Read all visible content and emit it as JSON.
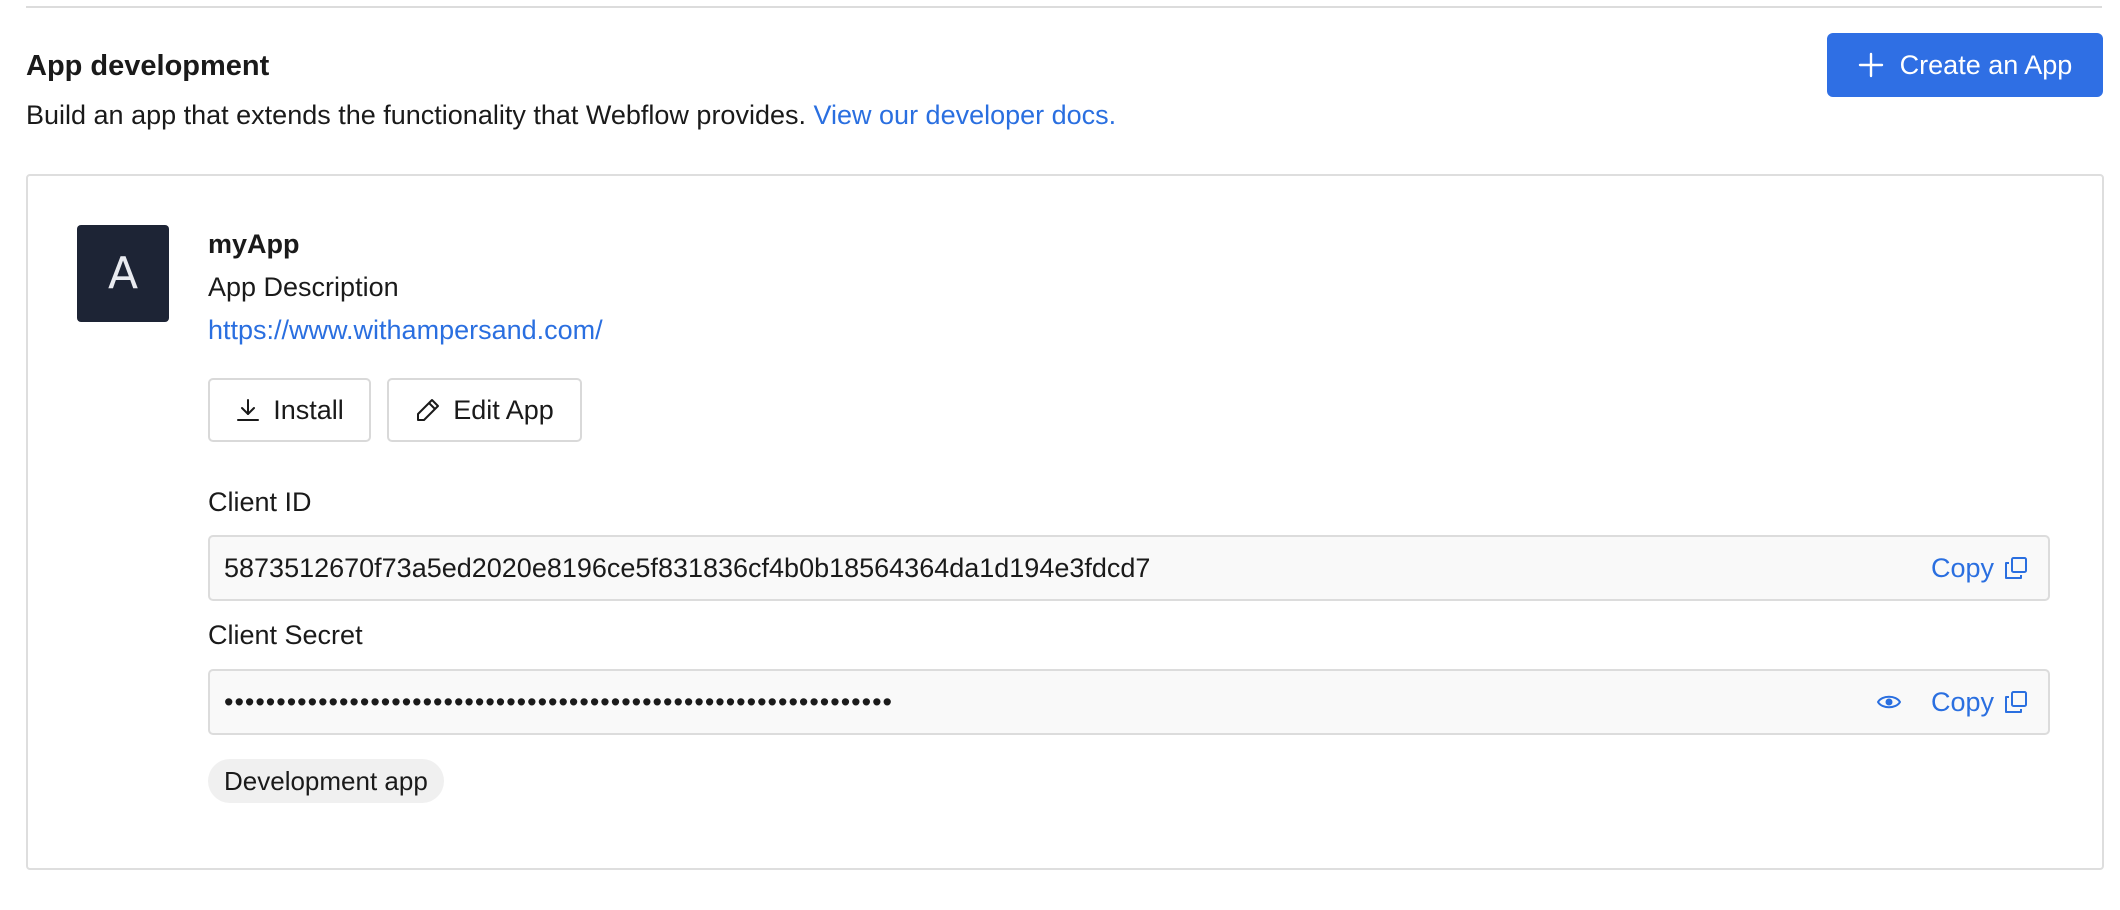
{
  "section": {
    "title": "App development",
    "description": "Build an app that extends the functionality that Webflow provides.",
    "docs_link": "View our developer docs.",
    "create_button": "Create an App"
  },
  "app": {
    "avatar_letter": "A",
    "name": "myApp",
    "description": "App Description",
    "url": "https://www.withampersand.com/",
    "install_button": "Install",
    "edit_button": "Edit App",
    "client_id_label": "Client ID",
    "client_id_value": "5873512670f73a5ed2020e8196ce5f831836cf4b0b18564364da1d194e3fdcd7",
    "client_secret_label": "Client Secret",
    "client_secret_value": "••••••••••••••••••••••••••••••••••••••••••••••••••••••••••••••••",
    "copy_label": "Copy",
    "badge": "Development app"
  },
  "colors": {
    "accent": "#2f6fe4",
    "link": "#2a6fe0",
    "avatar_bg": "#1d2435"
  },
  "icons": {
    "create": "plus-icon",
    "install": "download-icon",
    "edit": "pencil-icon",
    "copy": "copy-icon",
    "reveal": "eye-icon"
  }
}
